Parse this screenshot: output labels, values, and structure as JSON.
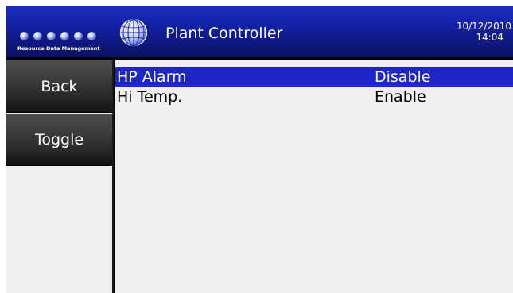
{
  "header": {
    "logo_text": "Resource Data Management",
    "title": "Plant Controller",
    "date": "10/12/2010",
    "time": "14:04",
    "globe_icon": "globe-icon",
    "accent_color": "#1422a8"
  },
  "sidebar": {
    "buttons": [
      {
        "label": "Back"
      },
      {
        "label": "Toggle"
      }
    ]
  },
  "list": {
    "selected_color": "#1f26c8",
    "rows": [
      {
        "name": "HP Alarm",
        "value": "Disable",
        "selected": true
      },
      {
        "name": "Hi Temp.",
        "value": "Enable",
        "selected": false
      }
    ]
  }
}
